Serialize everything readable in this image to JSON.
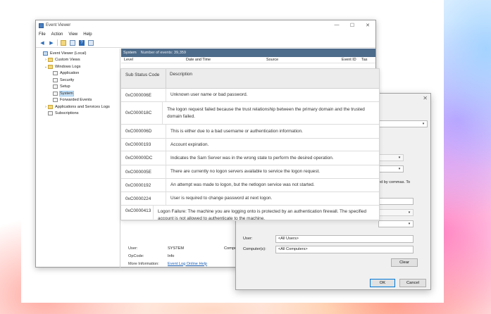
{
  "window": {
    "title": "Event Viewer",
    "controls": [
      "—",
      "☐",
      "✕"
    ]
  },
  "menu": [
    "File",
    "Action",
    "View",
    "Help"
  ],
  "tree": {
    "items": [
      {
        "label": "Event Viewer (Local)",
        "depth": 0,
        "arrow": "",
        "icon": "event-viewer-icon"
      },
      {
        "label": "Custom Views",
        "depth": 1,
        "arrow": "›",
        "icon": "folder-icon"
      },
      {
        "label": "Windows Logs",
        "depth": 1,
        "arrow": "⌄",
        "icon": "folder-icon"
      },
      {
        "label": "Application",
        "depth": 2,
        "arrow": "",
        "icon": "log-icon"
      },
      {
        "label": "Security",
        "depth": 2,
        "arrow": "",
        "icon": "log-icon"
      },
      {
        "label": "Setup",
        "depth": 2,
        "arrow": "",
        "icon": "log-icon"
      },
      {
        "label": "System",
        "depth": 2,
        "arrow": "",
        "icon": "log-icon",
        "selected": true
      },
      {
        "label": "Forwarded Events",
        "depth": 2,
        "arrow": "",
        "icon": "log-icon"
      },
      {
        "label": "Applications and Services Logs",
        "depth": 1,
        "arrow": "›",
        "icon": "folder-icon"
      },
      {
        "label": "Subscriptions",
        "depth": 1,
        "arrow": "",
        "icon": "log-icon"
      }
    ]
  },
  "main": {
    "log_name": "System",
    "event_count": "Number of events: 39,359",
    "columns": [
      "Level",
      "Date and Time",
      "Source",
      "Event ID",
      "Tas"
    ]
  },
  "detail": {
    "rows": [
      {
        "key": "User:",
        "value": "SYSTEM",
        "extra": "Compu"
      },
      {
        "key": "OpCode:",
        "value": "Info"
      },
      {
        "key": "More Information:",
        "value": "Event Log Online Help",
        "link": true
      }
    ]
  },
  "status_table": {
    "header_code": "Sub Status Code",
    "header_desc": "Description",
    "rows": [
      {
        "code": "0xC000006E",
        "desc": "Unknown user name or bad password."
      },
      {
        "code": "0xC000018C",
        "desc": "The logon request failed because the trust relationship between the primary domain and the trusted domain failed."
      },
      {
        "code": "0xC000006D",
        "desc": "This is either due to a bad username or authentication information."
      },
      {
        "code": "0xC0000193",
        "desc": "Account expiration."
      },
      {
        "code": "0xC00000DC",
        "desc": "Indicates the Sam Server was in the wrong state to perform the desired operation."
      },
      {
        "code": "0xC000005E",
        "desc": "There are currently no logon servers available to service the logon request."
      },
      {
        "code": "0xC0000192",
        "desc": "An attempt was made to logon, but the netlogon service was not started."
      },
      {
        "code": "0xC0000224",
        "desc": "User is required to change password at next logon."
      },
      {
        "code": "0xC0000413",
        "desc": "Logon Failure: The machine you are logging onto is protected by an authentication firewall. The specified account is not allowed to authenticate to the machine."
      }
    ]
  },
  "dialog": {
    "close": "✕",
    "commas_fragment": "ed by commas. To",
    "user_label": "User:",
    "user_value": "<All Users>",
    "computer_label": "Computer(s):",
    "computer_value": "<All Computers>",
    "clear_label": "Clear",
    "ok_label": "OK",
    "cancel_label": "Cancel"
  },
  "colors": {
    "header_bar": "#4d6b8a",
    "selection": "#cce4f7",
    "link": "#1a5fb4",
    "ok_border": "#0078d7"
  }
}
